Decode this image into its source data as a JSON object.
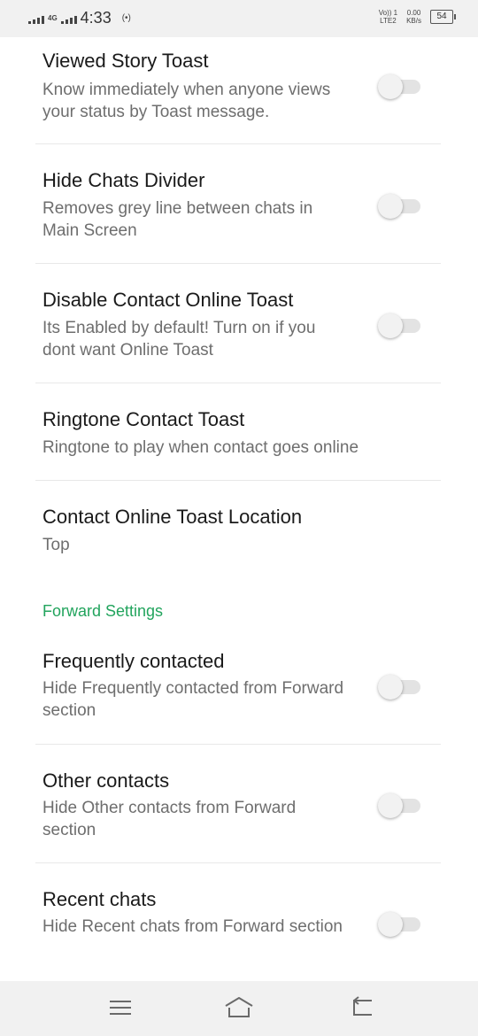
{
  "status_bar": {
    "network": "4G",
    "time": "4:33",
    "volte_top": "Vo)) 1",
    "volte_bottom": "LTE2",
    "speed_value": "0.00",
    "speed_unit": "KB/s",
    "battery": "54"
  },
  "settings": [
    {
      "title": "Viewed Story Toast",
      "summary": "Know immediately when anyone views your status by Toast message.",
      "toggle": false
    },
    {
      "title": "Hide Chats Divider",
      "summary": "Removes grey line between chats in Main Screen",
      "toggle": false
    },
    {
      "title": "Disable Contact Online Toast",
      "summary": "Its Enabled by default! Turn on if you dont want Online Toast",
      "toggle": false
    },
    {
      "title": "Ringtone Contact Toast",
      "summary": "Ringtone to play when contact goes online"
    },
    {
      "title": "Contact Online Toast Location",
      "summary": "Top"
    }
  ],
  "forward_section": {
    "header": "Forward Settings",
    "items": [
      {
        "title": "Frequently contacted",
        "summary": "Hide Frequently contacted from Forward section",
        "toggle": false
      },
      {
        "title": "Other contacts",
        "summary": "Hide Other contacts from Forward section",
        "toggle": false
      },
      {
        "title": "Recent chats",
        "summary": "Hide Recent chats from Forward section",
        "toggle": false
      }
    ]
  },
  "colors": {
    "accent": "#22a45d",
    "title": "#1a1a1a",
    "summary": "#6e6e6e",
    "divider": "#e8e8e8"
  },
  "nav_icons": [
    "menu-icon",
    "home-icon",
    "back-icon"
  ]
}
